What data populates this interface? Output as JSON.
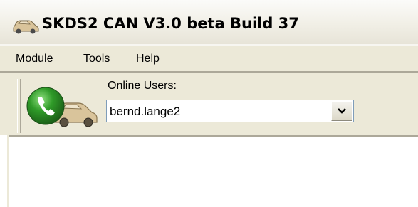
{
  "window": {
    "title": "SKDS2  CAN V3.0 beta Build 37",
    "icon": "car-app-icon"
  },
  "menu": {
    "items": [
      {
        "label": "Module"
      },
      {
        "label": "Tools"
      },
      {
        "label": "Help"
      }
    ]
  },
  "toolbar": {
    "connect_icon": "phone-car-icon",
    "online_users_label": "Online Users:",
    "online_users_value": "bernd.lange2",
    "dropdown_icon": "chevron-down-icon"
  },
  "colors": {
    "window_bg": "#ece9d8",
    "title_bg": "#f1efe6",
    "phone_green": "#2f8d2a",
    "car_tan": "#d9c49b"
  }
}
